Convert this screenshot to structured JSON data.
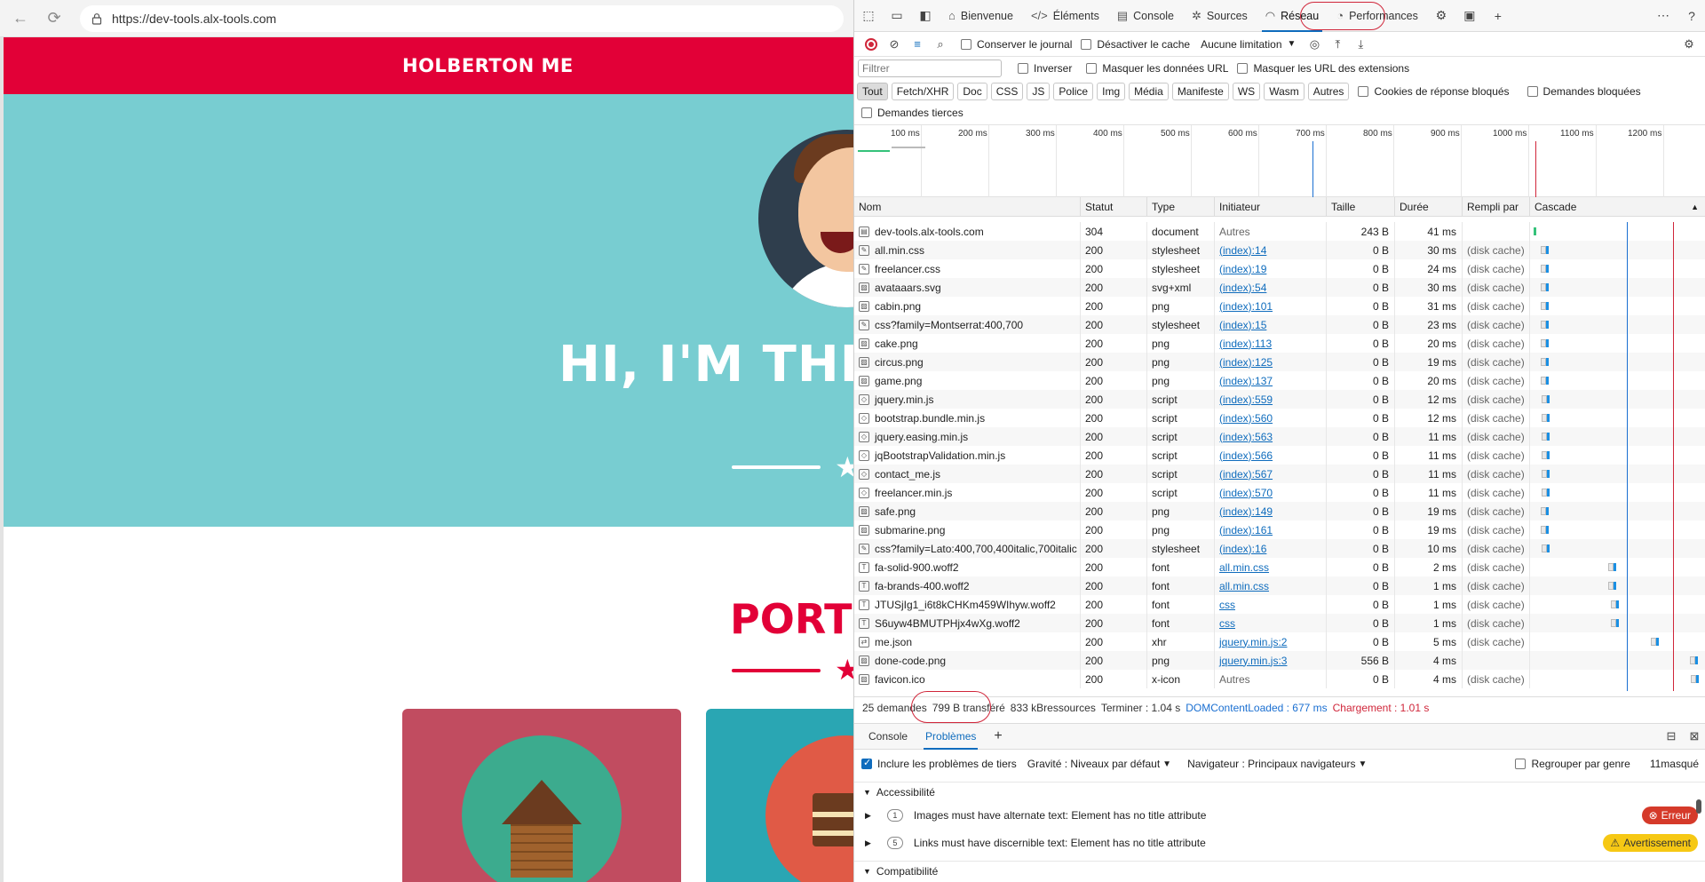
{
  "browser": {
    "url": "https://dev-tools.alx-tools.com"
  },
  "site": {
    "brand": "HOLBERTON ME",
    "hero_title": "HI, I'M THE",
    "portfolio_title": "PORTF"
  },
  "devtools": {
    "tabs": [
      {
        "label": "Bienvenue",
        "icon": "home-icon"
      },
      {
        "label": "Éléments",
        "icon": "code-icon"
      },
      {
        "label": "Console",
        "icon": "console-icon"
      },
      {
        "label": "Sources",
        "icon": "bug-icon"
      },
      {
        "label": "Réseau",
        "icon": "wifi-icon",
        "active": true
      },
      {
        "label": "Performances",
        "icon": "performance-icon"
      }
    ],
    "toolbar": {
      "preserve_log": "Conserver le journal",
      "disable_cache": "Désactiver le cache",
      "throttle": "Aucune limitation"
    },
    "filter": {
      "placeholder": "Filtrer",
      "invert": "Inverser",
      "hide_data_urls": "Masquer les données URL",
      "hide_extension_urls": "Masquer les URL des extensions"
    },
    "type_filters": [
      "Tout",
      "Fetch/XHR",
      "Doc",
      "CSS",
      "JS",
      "Police",
      "Img",
      "Média",
      "Manifeste",
      "WS",
      "Wasm",
      "Autres"
    ],
    "blocked_cookies": "Cookies de réponse bloqués",
    "blocked_requests": "Demandes bloquées",
    "third_party": "Demandes tierces",
    "overview_ticks": [
      "100 ms",
      "200 ms",
      "300 ms",
      "400 ms",
      "500 ms",
      "600 ms",
      "700 ms",
      "800 ms",
      "900 ms",
      "1000 ms",
      "1100 ms",
      "1200 ms"
    ],
    "columns": {
      "name": "Nom",
      "status": "Statut",
      "type": "Type",
      "initiator": "Initiateur",
      "size": "Taille",
      "duration": "Durée",
      "fulfilled": "Rempli par",
      "waterfall": "Cascade"
    },
    "requests": [
      {
        "name": "dev-tools.alx-tools.com",
        "status": "304",
        "type": "document",
        "initiator": "Autres",
        "link": false,
        "size": "243 B",
        "time": "41 ms",
        "fulfilled": "",
        "wf_start": 0,
        "wf_ms": 41,
        "icon": "doc"
      },
      {
        "name": "all.min.css",
        "status": "200",
        "type": "stylesheet",
        "initiator": "(index):14",
        "link": true,
        "size": "0 B",
        "time": "30 ms",
        "fulfilled": "(disk cache)",
        "wf_start": 50,
        "wf_ms": 30,
        "icon": "css"
      },
      {
        "name": "freelancer.css",
        "status": "200",
        "type": "stylesheet",
        "initiator": "(index):19",
        "link": true,
        "size": "0 B",
        "time": "24 ms",
        "fulfilled": "(disk cache)",
        "wf_start": 50,
        "wf_ms": 24,
        "icon": "css"
      },
      {
        "name": "avataaars.svg",
        "status": "200",
        "type": "svg+xml",
        "initiator": "(index):54",
        "link": true,
        "size": "0 B",
        "time": "30 ms",
        "fulfilled": "(disk cache)",
        "wf_start": 50,
        "wf_ms": 30,
        "icon": "img"
      },
      {
        "name": "cabin.png",
        "status": "200",
        "type": "png",
        "initiator": "(index):101",
        "link": true,
        "size": "0 B",
        "time": "31 ms",
        "fulfilled": "(disk cache)",
        "wf_start": 50,
        "wf_ms": 31,
        "icon": "img"
      },
      {
        "name": "css?family=Montserrat:400,700",
        "status": "200",
        "type": "stylesheet",
        "initiator": "(index):15",
        "link": true,
        "size": "0 B",
        "time": "23 ms",
        "fulfilled": "(disk cache)",
        "wf_start": 50,
        "wf_ms": 23,
        "icon": "css"
      },
      {
        "name": "cake.png",
        "status": "200",
        "type": "png",
        "initiator": "(index):113",
        "link": true,
        "size": "0 B",
        "time": "20 ms",
        "fulfilled": "(disk cache)",
        "wf_start": 52,
        "wf_ms": 20,
        "icon": "img"
      },
      {
        "name": "circus.png",
        "status": "200",
        "type": "png",
        "initiator": "(index):125",
        "link": true,
        "size": "0 B",
        "time": "19 ms",
        "fulfilled": "(disk cache)",
        "wf_start": 52,
        "wf_ms": 19,
        "icon": "img"
      },
      {
        "name": "game.png",
        "status": "200",
        "type": "png",
        "initiator": "(index):137",
        "link": true,
        "size": "0 B",
        "time": "20 ms",
        "fulfilled": "(disk cache)",
        "wf_start": 52,
        "wf_ms": 20,
        "icon": "img"
      },
      {
        "name": "jquery.min.js",
        "status": "200",
        "type": "script",
        "initiator": "(index):559",
        "link": true,
        "size": "0 B",
        "time": "12 ms",
        "fulfilled": "(disk cache)",
        "wf_start": 55,
        "wf_ms": 12,
        "icon": "js"
      },
      {
        "name": "bootstrap.bundle.min.js",
        "status": "200",
        "type": "script",
        "initiator": "(index):560",
        "link": true,
        "size": "0 B",
        "time": "12 ms",
        "fulfilled": "(disk cache)",
        "wf_start": 55,
        "wf_ms": 12,
        "icon": "js"
      },
      {
        "name": "jquery.easing.min.js",
        "status": "200",
        "type": "script",
        "initiator": "(index):563",
        "link": true,
        "size": "0 B",
        "time": "11 ms",
        "fulfilled": "(disk cache)",
        "wf_start": 55,
        "wf_ms": 11,
        "icon": "js"
      },
      {
        "name": "jqBootstrapValidation.min.js",
        "status": "200",
        "type": "script",
        "initiator": "(index):566",
        "link": true,
        "size": "0 B",
        "time": "11 ms",
        "fulfilled": "(disk cache)",
        "wf_start": 55,
        "wf_ms": 11,
        "icon": "js"
      },
      {
        "name": "contact_me.js",
        "status": "200",
        "type": "script",
        "initiator": "(index):567",
        "link": true,
        "size": "0 B",
        "time": "11 ms",
        "fulfilled": "(disk cache)",
        "wf_start": 55,
        "wf_ms": 11,
        "icon": "js"
      },
      {
        "name": "freelancer.min.js",
        "status": "200",
        "type": "script",
        "initiator": "(index):570",
        "link": true,
        "size": "0 B",
        "time": "11 ms",
        "fulfilled": "(disk cache)",
        "wf_start": 55,
        "wf_ms": 11,
        "icon": "js"
      },
      {
        "name": "safe.png",
        "status": "200",
        "type": "png",
        "initiator": "(index):149",
        "link": true,
        "size": "0 B",
        "time": "19 ms",
        "fulfilled": "(disk cache)",
        "wf_start": 52,
        "wf_ms": 19,
        "icon": "img"
      },
      {
        "name": "submarine.png",
        "status": "200",
        "type": "png",
        "initiator": "(index):161",
        "link": true,
        "size": "0 B",
        "time": "19 ms",
        "fulfilled": "(disk cache)",
        "wf_start": 52,
        "wf_ms": 19,
        "icon": "img"
      },
      {
        "name": "css?family=Lato:400,700,400italic,700italic",
        "status": "200",
        "type": "stylesheet",
        "initiator": "(index):16",
        "link": true,
        "size": "0 B",
        "time": "10 ms",
        "fulfilled": "(disk cache)",
        "wf_start": 55,
        "wf_ms": 10,
        "icon": "css"
      },
      {
        "name": "fa-solid-900.woff2",
        "status": "200",
        "type": "font",
        "initiator": "all.min.css",
        "link": true,
        "size": "0 B",
        "time": "2 ms",
        "fulfilled": "(disk cache)",
        "wf_start": 540,
        "wf_ms": 2,
        "icon": "font"
      },
      {
        "name": "fa-brands-400.woff2",
        "status": "200",
        "type": "font",
        "initiator": "all.min.css",
        "link": true,
        "size": "0 B",
        "time": "1 ms",
        "fulfilled": "(disk cache)",
        "wf_start": 540,
        "wf_ms": 1,
        "icon": "font"
      },
      {
        "name": "JTUSjIg1_i6t8kCHKm459WIhyw.woff2",
        "status": "200",
        "type": "font",
        "initiator": "css",
        "link": true,
        "size": "0 B",
        "time": "1 ms",
        "fulfilled": "(disk cache)",
        "wf_start": 560,
        "wf_ms": 1,
        "icon": "font"
      },
      {
        "name": "S6uyw4BMUTPHjx4wXg.woff2",
        "status": "200",
        "type": "font",
        "initiator": "css",
        "link": true,
        "size": "0 B",
        "time": "1 ms",
        "fulfilled": "(disk cache)",
        "wf_start": 560,
        "wf_ms": 1,
        "icon": "font"
      },
      {
        "name": "me.json",
        "status": "200",
        "type": "xhr",
        "initiator": "jquery.min.js:2",
        "link": true,
        "size": "0 B",
        "time": "5 ms",
        "fulfilled": "(disk cache)",
        "wf_start": 850,
        "wf_ms": 5,
        "icon": "xhr"
      },
      {
        "name": "done-code.png",
        "status": "200",
        "type": "png",
        "initiator": "jquery.min.js:3",
        "link": true,
        "size": "556 B",
        "time": "4 ms",
        "fulfilled": "",
        "wf_start": 1130,
        "wf_ms": 4,
        "icon": "img"
      },
      {
        "name": "favicon.ico",
        "status": "200",
        "type": "x-icon",
        "initiator": "Autres",
        "link": false,
        "size": "0 B",
        "time": "4 ms",
        "fulfilled": "(disk cache)",
        "wf_start": 1135,
        "wf_ms": 4,
        "icon": "img"
      }
    ],
    "summary": {
      "requests": "25 demandes",
      "transferred": "799 B transféré",
      "resources": "833 kBressources",
      "finish": "Terminer : 1.04 s",
      "dcl": "DOMContentLoaded : 677 ms",
      "load": "Chargement : 1.01 s"
    },
    "drawer": {
      "tabs": [
        "Console",
        "Problèmes"
      ],
      "active": "Problèmes",
      "include_third_party": "Inclure les problèmes de tiers",
      "severity": "Gravité : Niveaux par défaut",
      "browser": "Navigateur : Principaux navigateurs",
      "group_by_kind": "Regrouper par genre",
      "hidden": "11masqué",
      "categories": [
        "Accessibilité",
        "Compatibilité"
      ],
      "issues": [
        {
          "count": "1",
          "text": "Images must have alternate text: Element has no title attribute",
          "badge": "Erreur",
          "level": "error"
        },
        {
          "count": "5",
          "text": "Links must have discernible text: Element has no title attribute",
          "badge": "Avertissement",
          "level": "warning"
        }
      ]
    },
    "colors": {
      "accent": "#0f6cbd",
      "record": "#d0263a",
      "dcl_line": "#1a6fd1",
      "load_line": "#d0263a"
    },
    "waterfall_max_ms": 1170,
    "dcl_ms": 677,
    "load_ms": 1010
  }
}
